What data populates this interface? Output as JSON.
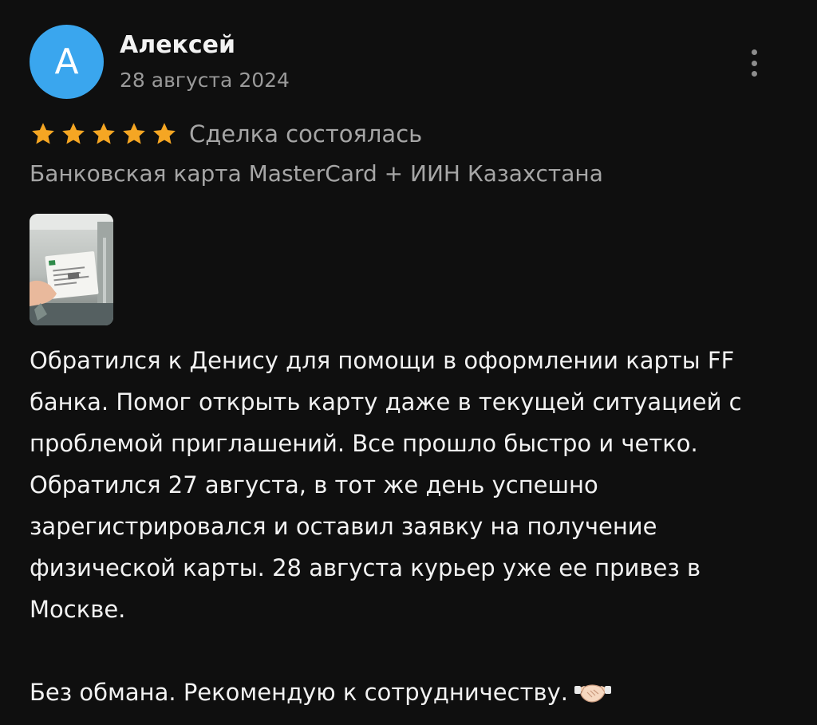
{
  "review": {
    "avatar_letter": "А",
    "avatar_color": "#3aa6ee",
    "author": "Алексей",
    "date": "28 августа 2024",
    "menu_icon": "more-vertical-icon",
    "rating": 5,
    "rating_max": 5,
    "star_color": "#f5a623",
    "deal_status": "Сделка состоялась",
    "service": "Банковская карта MasterCard + ИИН Казахстана",
    "photo_count": 1,
    "text_paragraph_1": "Обратился к Денису для помощи в оформлении карты FF банка. Помог открыть карту даже в текущей ситуацией с проблемой приглашений. Все прошло быстро и четко. Обратился 27 августа, в тот же день успешно зарегистрировался и оставил заявку на получение физической карты. 28 августа курьер уже ее привез в Москве.",
    "text_paragraph_2": "Без обмана. Рекомендую к сотрудничеству.",
    "emoji_icon": "handshake-icon"
  }
}
